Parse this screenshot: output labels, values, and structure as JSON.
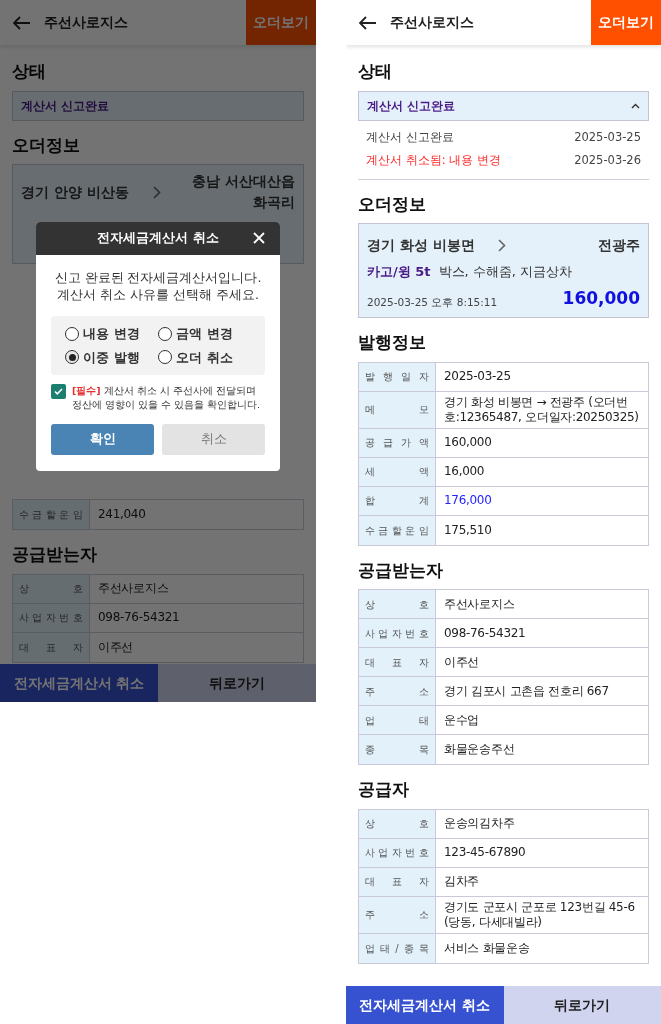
{
  "screens": [
    {
      "header": {
        "title": "주선사로지스",
        "action": "오더보기"
      },
      "status": {
        "heading": "상태",
        "current": "계산서 신고완료"
      },
      "order": {
        "heading": "오더정보",
        "from": "경기 안양 비산동",
        "to": "충남 서산대산읍 화곡리"
      },
      "sections": [
        {
          "rows": [
            {
              "label": "수 금 할 운 임",
              "value": "241,040"
            }
          ]
        },
        {
          "heading": "공급받는자",
          "rows": [
            {
              "label": "상 호",
              "value": "주선사로지스"
            },
            {
              "label": "사 업 자 번 호",
              "value": "098-76-54321"
            },
            {
              "label": "대 표 자",
              "value": "이주선"
            }
          ]
        }
      ],
      "footer": {
        "primary": "전자세금계산서 취소",
        "secondary": "뒤로가기"
      },
      "modal": {
        "title": "전자세금계산서 취소",
        "message": "신고 완료된 전자세금계산서입니다.\n계산서 취소 사유를 선택해 주세요.",
        "reasons": [
          {
            "label": "내용 변경",
            "selected": false
          },
          {
            "label": "금액 변경",
            "selected": false
          },
          {
            "label": "이중 발행",
            "selected": true
          },
          {
            "label": "오더 취소",
            "selected": false
          }
        ],
        "consent": {
          "checked": true,
          "tag": "[필수]",
          "text": "계산서 취소 시 주선사에 전달되며 정산에 영향이 있을 수 있음을 확인합니다."
        },
        "confirm": "확인",
        "cancel": "취소"
      }
    },
    {
      "header": {
        "title": "주선사로지스",
        "action": "오더보기"
      },
      "status": {
        "heading": "상태",
        "current": "계산서 신고완료",
        "expanded": true,
        "history": [
          {
            "text": "계산서 신고완료",
            "date": "2025-03-25",
            "kind": "done"
          },
          {
            "text": "계산서 취소됨: 내용 변경",
            "date": "2025-03-26",
            "kind": "cancelled"
          }
        ]
      },
      "order": {
        "heading": "오더정보",
        "from": "경기 화성 비봉면",
        "to": "전광주",
        "cargo_type": "카고/윙 5t",
        "cargo": "박스, 수해줌, 지금상차",
        "datetime": "2025-03-25 오후 8:15:11",
        "amount": "160,000"
      },
      "sections": [
        {
          "heading": "발행정보",
          "rows": [
            {
              "label": "발 행 일 자",
              "value": "2025-03-25"
            },
            {
              "label": "메 모",
              "value": "경기 화성 비봉면 → 전광주 (오더번호:12365487, 오더일자:20250325)"
            },
            {
              "label": "공 급 가 액",
              "value": "160,000"
            },
            {
              "label": "세 액",
              "value": "16,000"
            },
            {
              "label": "합 계",
              "value": "176,000",
              "highlight": true
            },
            {
              "label": "수 금 할 운 임",
              "value": "175,510"
            }
          ]
        },
        {
          "heading": "공급받는자",
          "rows": [
            {
              "label": "상 호",
              "value": "주선사로지스"
            },
            {
              "label": "사 업 자 번 호",
              "value": "098-76-54321"
            },
            {
              "label": "대 표 자",
              "value": "이주선"
            },
            {
              "label": "주 소",
              "value": "경기 김포시 고촌읍 전호리 667"
            },
            {
              "label": "업 태",
              "value": "운수업"
            },
            {
              "label": "종 목",
              "value": "화물운송주선"
            }
          ]
        },
        {
          "heading": "공급자",
          "rows": [
            {
              "label": "상 호",
              "value": "운송의김차주"
            },
            {
              "label": "사 업 자 번 호",
              "value": "123-45-67890"
            },
            {
              "label": "대 표 자",
              "value": "김차주"
            },
            {
              "label": "주 소",
              "value": "경기도 군포시 군포로 123번길 45-6 (당동, 다세대빌라)"
            },
            {
              "label": "업 태 / 종 목",
              "value": "서비스 화물운송"
            }
          ]
        }
      ],
      "footer": {
        "primary": "전자세금계산서 취소",
        "secondary": "뒤로가기"
      }
    }
  ]
}
